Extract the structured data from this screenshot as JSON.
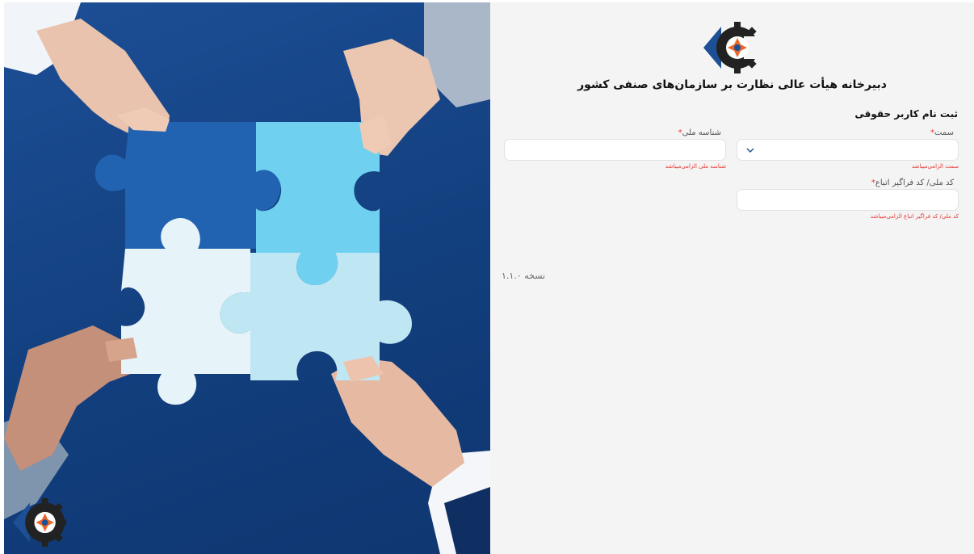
{
  "org": {
    "title": "دبیرخانه هیأت عالی نظارت بر سازمان‌های صنفی کشور"
  },
  "form": {
    "title": "ثبت نام کاربر حقوقی",
    "position": {
      "label": "سمت",
      "required_mark": "*",
      "error": "سمت الزامی‌میباشد"
    },
    "national_id": {
      "label": "شناسه ملی",
      "required_mark": "*",
      "error": "شناسه ملی الزامی‌میباشد"
    },
    "national_code": {
      "label": "کد ملی/ کد فراگیر اتباع",
      "required_mark": "*",
      "error": "کد ملی/ کد فراگیر اتباع الزامی‌میباشد"
    }
  },
  "version": "نسخه ۱.۱.۰",
  "colors": {
    "accent_blue": "#1d4f96",
    "logo_orange": "#e8682c",
    "error_red": "#e53935"
  },
  "icons": [
    "logo-gear-icon",
    "chevron-down-icon"
  ]
}
